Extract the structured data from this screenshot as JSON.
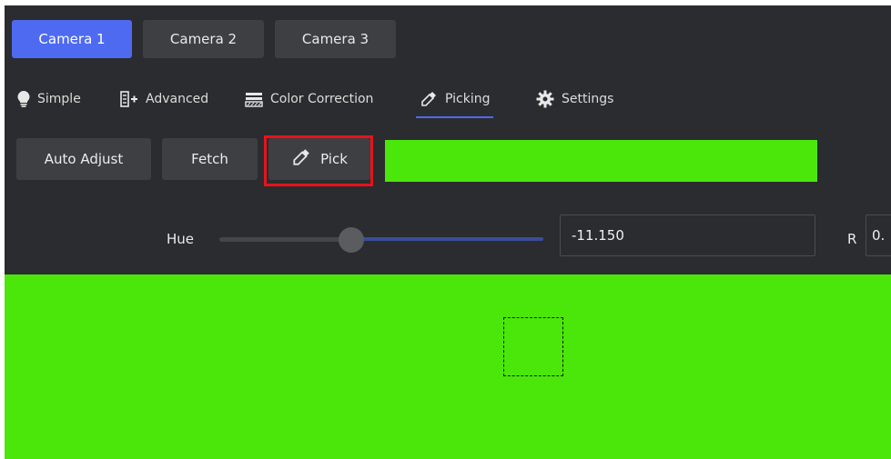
{
  "cameras": [
    {
      "label": "Camera 1",
      "active": true
    },
    {
      "label": "Camera 2",
      "active": false
    },
    {
      "label": "Camera 3",
      "active": false
    }
  ],
  "tabs": [
    {
      "label": "Simple",
      "icon": "lightbulb-icon"
    },
    {
      "label": "Advanced",
      "icon": "advanced-icon"
    },
    {
      "label": "Color Correction",
      "icon": "color-correction-icon"
    },
    {
      "label": "Picking",
      "icon": "eyedropper-icon",
      "active": true
    },
    {
      "label": "Settings",
      "icon": "gear-icon"
    }
  ],
  "toolbar": {
    "auto_adjust_label": "Auto Adjust",
    "fetch_label": "Fetch",
    "pick_label": "Pick",
    "picked_color": "#4be70a"
  },
  "hue": {
    "label": "Hue",
    "value": "-11.150"
  },
  "rgb": {
    "r_label": "R",
    "r_value": "0."
  },
  "colors": {
    "accent": "#4e6af0",
    "highlight": "#e8121b",
    "preview_green": "#4be70a",
    "background": "#2b2c2f"
  }
}
